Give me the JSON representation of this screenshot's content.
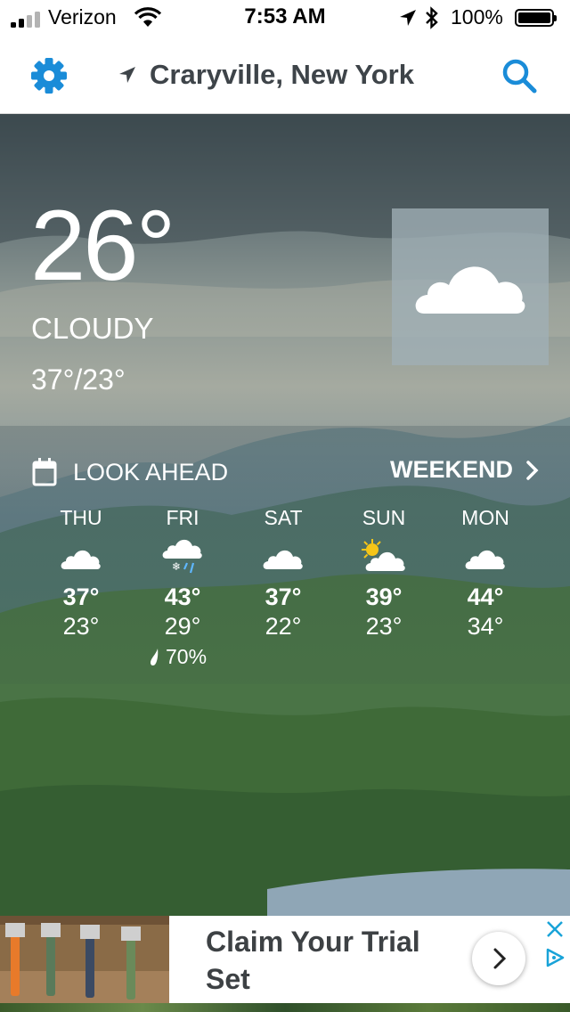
{
  "status_bar": {
    "carrier": "Verizon",
    "time": "7:53 AM",
    "battery": "100%"
  },
  "header": {
    "location": "Craryville, New York"
  },
  "current": {
    "temperature": "26°",
    "condition": "CLOUDY",
    "hi_lo": "37°/23°",
    "icon": "cloud-icon"
  },
  "look_ahead": {
    "title": "LOOK AHEAD",
    "weekend_label": "WEEKEND",
    "days": [
      {
        "name": "THU",
        "icon": "cloud-icon",
        "high": "37°",
        "low": "23°"
      },
      {
        "name": "FRI",
        "icon": "cloud-snow-rain-icon",
        "high": "43°",
        "low": "29°",
        "precip": "70%"
      },
      {
        "name": "SAT",
        "icon": "cloud-icon",
        "high": "37°",
        "low": "22°"
      },
      {
        "name": "SUN",
        "icon": "partly-sunny-icon",
        "high": "39°",
        "low": "23°"
      },
      {
        "name": "MON",
        "icon": "cloud-icon",
        "high": "44°",
        "low": "34°"
      }
    ]
  },
  "ad": {
    "text": "Claim Your Trial Set"
  },
  "colors": {
    "accent": "#1a8cd8",
    "title_text": "#3e4449"
  }
}
